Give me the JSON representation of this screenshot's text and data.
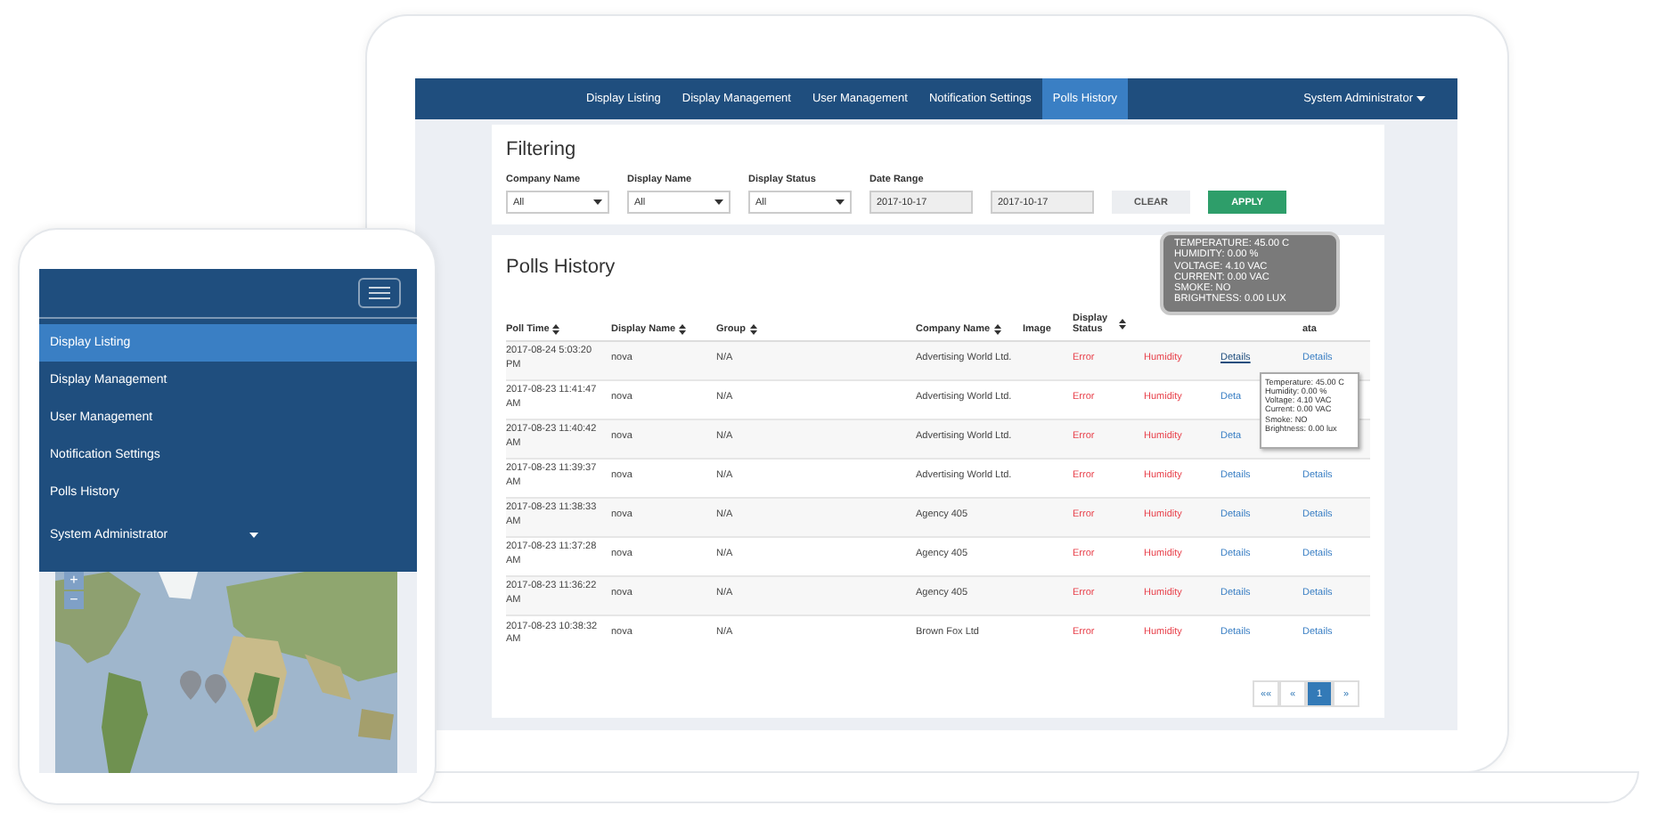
{
  "laptop": {
    "nav": {
      "items": [
        {
          "label": "Display Listing",
          "selected": false
        },
        {
          "label": "Display Management",
          "selected": false
        },
        {
          "label": "User Management",
          "selected": false
        },
        {
          "label": "Notification Settings",
          "selected": false
        },
        {
          "label": "Polls History",
          "selected": true
        }
      ],
      "user": "System Administrator"
    },
    "filtering": {
      "title": "Filtering",
      "fields": [
        {
          "label": "Company Name",
          "kind": "select",
          "value": "All"
        },
        {
          "label": "Display Name",
          "kind": "select",
          "value": "All"
        },
        {
          "label": "Display Status",
          "kind": "select",
          "value": "All"
        },
        {
          "label": "Date Range",
          "kind": "date",
          "value": "2017-10-17"
        },
        {
          "kind": "date",
          "value": "2017-10-17"
        }
      ],
      "buttons": [
        {
          "label": "CLEAR",
          "kind": "secondary"
        },
        {
          "label": "APPLY",
          "kind": "primary"
        }
      ]
    },
    "polls": {
      "title": "Polls History",
      "columns": [
        {
          "label": "Poll Time",
          "sortable": true
        },
        {
          "label": "Display Name",
          "sortable": true
        },
        {
          "label": "Group",
          "sortable": true
        },
        {
          "label": "Company Name",
          "sortable": true
        },
        {
          "label": "Image",
          "sortable": false
        },
        {
          "label": "Display Status",
          "sortable": true
        },
        null,
        null,
        {
          "label": "ata",
          "sortable": false
        }
      ],
      "rows": [
        {
          "cells": [
            "2017-08-24 5:03:20 PM",
            "nova",
            "N/A",
            "Advertising World Ltd.",
            null,
            "Error",
            "Humidity",
            "Details",
            "Details"
          ],
          "hovered": true
        },
        {
          "cells": [
            "2017-08-23 11:41:47 AM",
            "nova",
            "N/A",
            "Advertising World Ltd.",
            null,
            "Error",
            "Humidity",
            "Deta",
            null
          ],
          "hovered": false
        },
        {
          "cells": [
            "2017-08-23 11:40:42 AM",
            "nova",
            "N/A",
            "Advertising World Ltd.",
            null,
            "Error",
            "Humidity",
            "Deta",
            null
          ],
          "hovered": false
        },
        {
          "cells": [
            "2017-08-23 11:39:37 AM",
            "nova",
            "N/A",
            "Advertising World Ltd.",
            null,
            "Error",
            "Humidity",
            "Details",
            "Details"
          ],
          "hovered": false
        },
        {
          "cells": [
            "2017-08-23 11:38:33 AM",
            "nova",
            "N/A",
            "Agency 405",
            null,
            "Error",
            "Humidity",
            "Details",
            "Details"
          ],
          "hovered": false
        },
        {
          "cells": [
            "2017-08-23 11:37:28 AM",
            "nova",
            "N/A",
            "Agency 405",
            null,
            "Error",
            "Humidity",
            "Details",
            "Details"
          ],
          "hovered": false
        },
        {
          "cells": [
            "2017-08-23 11:36:22 AM",
            "nova",
            "N/A",
            "Agency 405",
            null,
            "Error",
            "Humidity",
            "Details",
            "Details"
          ],
          "hovered": false
        },
        {
          "cells": [
            "2017-08-23 10:38:32 AM",
            "nova",
            "N/A",
            "Brown Fox Ltd",
            null,
            "Error",
            "Humidity",
            "Details",
            "Details"
          ],
          "hovered": false
        }
      ],
      "pagination": [
        {
          "label": "««",
          "selected": false
        },
        {
          "label": "«",
          "selected": false
        },
        {
          "label": "1",
          "selected": true
        },
        {
          "label": "»",
          "selected": false
        }
      ]
    },
    "tooltips": [
      {
        "kind": "dark",
        "lines": [
          "TEMPERATURE: 45.00 C",
          "HUMIDITY: 0.00 %",
          "VOLTAGE: 4.10 VAC",
          "CURRENT: 0.00 VAC",
          "SMOKE: NO",
          "BRIGHTNESS: 0.00 LUX"
        ]
      },
      {
        "kind": "light",
        "lines": [
          "Temperature: 45.00 C",
          "Humidity: 0.00 %",
          "Voltage: 4.10 VAC",
          "Current: 0.00 VAC",
          "Smoke: NO",
          "Brightness: 0.00 lux"
        ]
      }
    ]
  },
  "phone": {
    "menu": [
      {
        "label": "Display Listing",
        "selected": true
      },
      {
        "label": "Display Management",
        "selected": false
      },
      {
        "label": "User Management",
        "selected": false
      },
      {
        "label": "Notification Settings",
        "selected": false
      },
      {
        "label": "Polls History",
        "selected": false
      }
    ],
    "user": "System Administrator",
    "zoom_controls": [
      "+",
      "−"
    ]
  }
}
